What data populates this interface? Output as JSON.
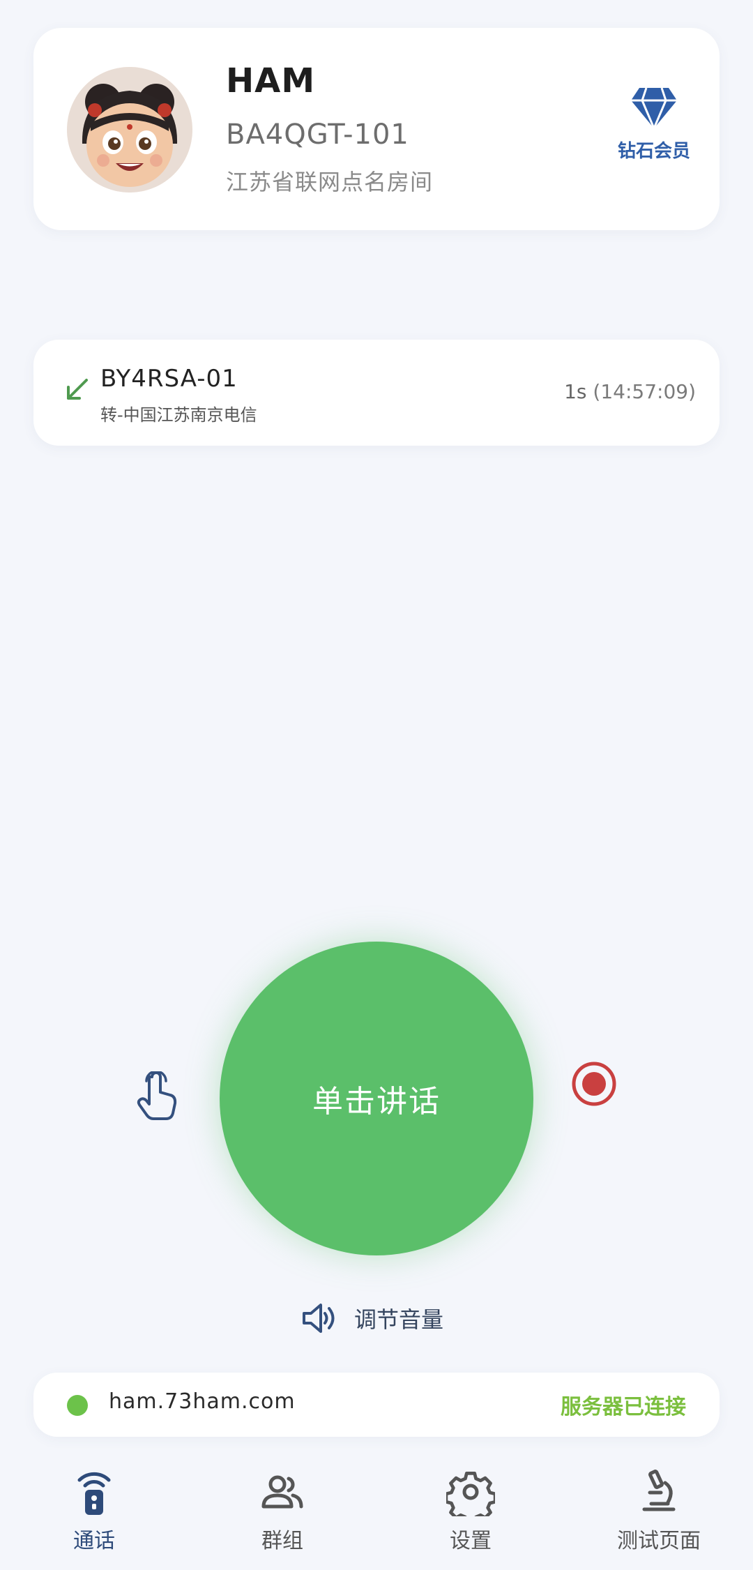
{
  "profile": {
    "name": "HAM",
    "callsign": "BA4QGT-101",
    "room": "江苏省联网点名房间",
    "member_label": "钻石会员"
  },
  "call": {
    "callsign": "BY4RSA-01",
    "location": "转-中国江苏南京电信",
    "duration": "1s",
    "time": "(14:57:09)",
    "direction": "incoming"
  },
  "ptt": {
    "label": "单击讲话"
  },
  "volume": {
    "label": "调节音量"
  },
  "server": {
    "host": "ham.73ham.com",
    "status": "服务器已连接"
  },
  "nav": {
    "items": [
      {
        "label": "通话",
        "icon": "radio-icon",
        "active": true
      },
      {
        "label": "群组",
        "icon": "people-icon",
        "active": false
      },
      {
        "label": "设置",
        "icon": "gear-icon",
        "active": false
      },
      {
        "label": "测试页面",
        "icon": "microscope-icon",
        "active": false
      }
    ]
  },
  "colors": {
    "ptt": "#5bbf6a",
    "diamond": "#2f5ea8",
    "connected": "#7bbf3e",
    "record": "#c94040",
    "accent": "#2e4b7a"
  }
}
